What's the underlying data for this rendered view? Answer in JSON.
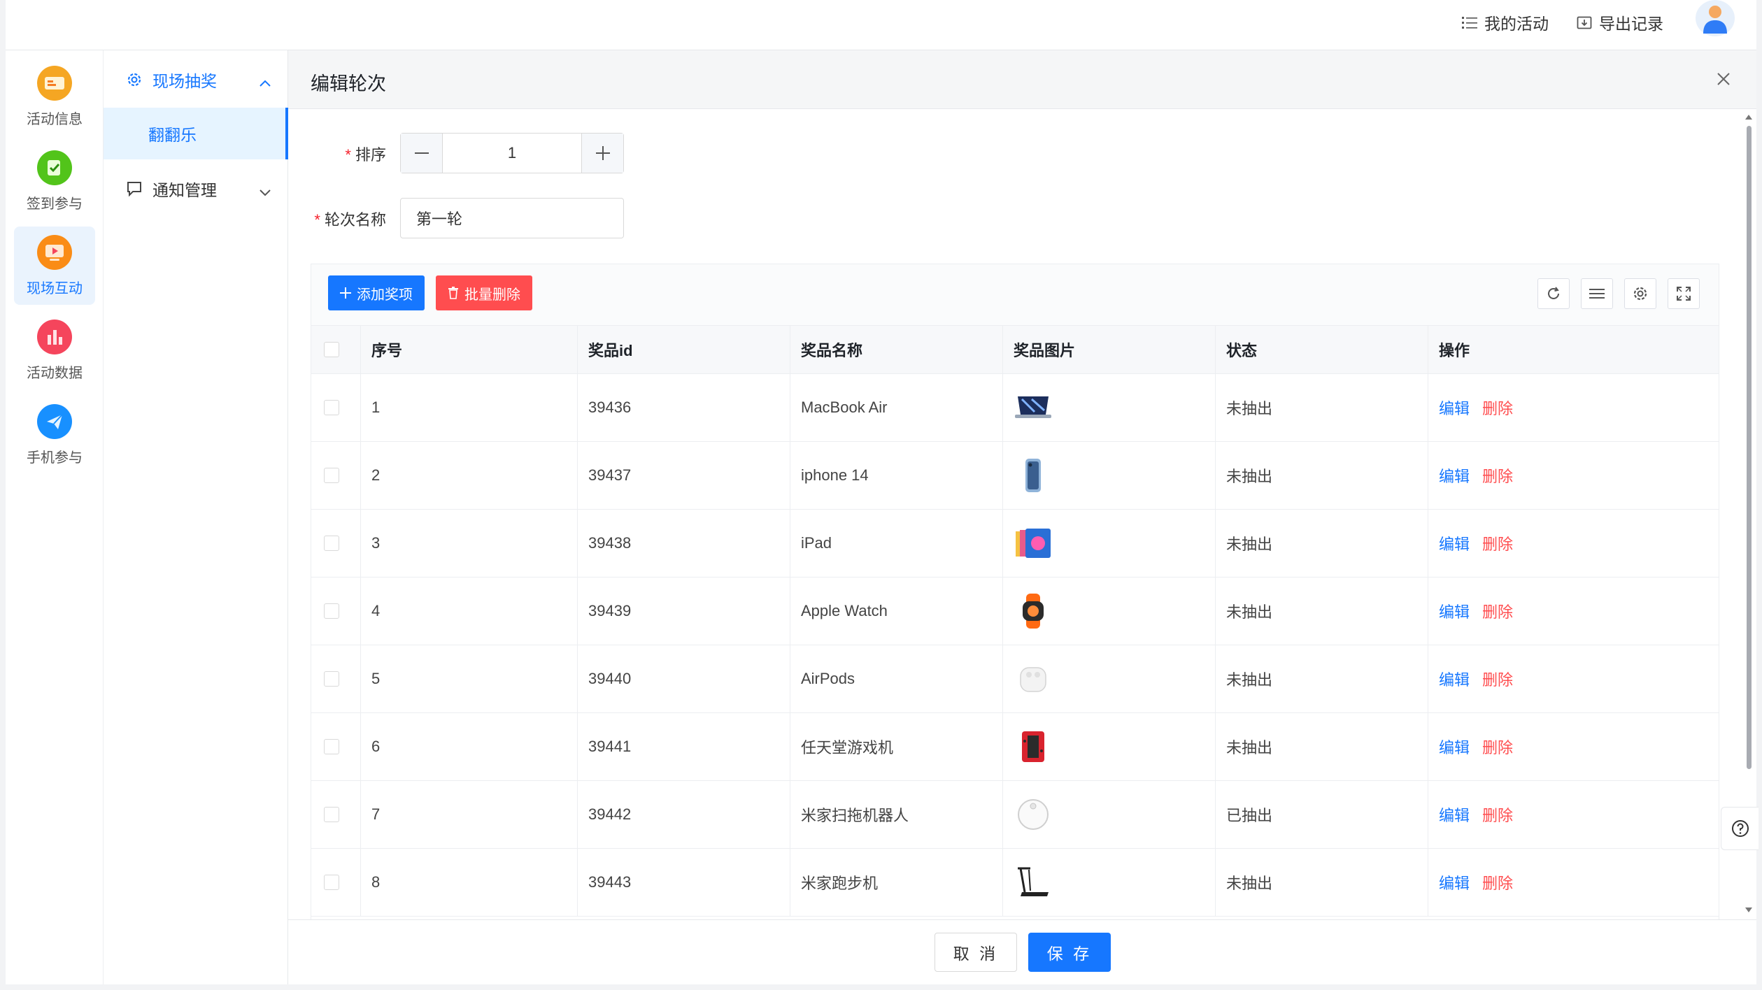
{
  "header": {
    "my_activities": "我的活动",
    "export_records": "导出记录"
  },
  "rail": {
    "items": [
      {
        "label": "活动信息",
        "icon": "ticket-icon",
        "color": "#f5a623"
      },
      {
        "label": "签到参与",
        "icon": "checkin-icon",
        "color": "#52c41a"
      },
      {
        "label": "现场互动",
        "icon": "live-play-icon",
        "color": "#fa8c16"
      },
      {
        "label": "活动数据",
        "icon": "bar-chart-icon",
        "color": "#f5455c"
      },
      {
        "label": "手机参与",
        "icon": "paper-plane-icon",
        "color": "#1890ff"
      }
    ],
    "active_index": 2
  },
  "submenu": {
    "group1": "现场抽奖",
    "group1_item": "翻翻乐",
    "group2": "通知管理"
  },
  "drawer": {
    "title": "编辑轮次",
    "sort_label": "排序",
    "sort_value": "1",
    "round_name_label": "轮次名称",
    "round_name_value": "第一轮",
    "add_prize": "添加奖项",
    "batch_delete": "批量删除",
    "cancel": "取 消",
    "save": "保 存"
  },
  "table": {
    "columns": [
      "序号",
      "奖品id",
      "奖品名称",
      "奖品图片",
      "状态",
      "操作"
    ],
    "edit_label": "编辑",
    "delete_label": "删除",
    "rows": [
      {
        "no": "1",
        "id": "39436",
        "name": "MacBook Air",
        "image": "laptop-icon",
        "status": "未抽出"
      },
      {
        "no": "2",
        "id": "39437",
        "name": "iphone 14",
        "image": "phone-icon",
        "status": "未抽出"
      },
      {
        "no": "3",
        "id": "39438",
        "name": "iPad",
        "image": "tablet-icon",
        "status": "未抽出"
      },
      {
        "no": "4",
        "id": "39439",
        "name": "Apple Watch",
        "image": "watch-icon",
        "status": "未抽出"
      },
      {
        "no": "5",
        "id": "39440",
        "name": "AirPods",
        "image": "earbuds-icon",
        "status": "未抽出"
      },
      {
        "no": "6",
        "id": "39441",
        "name": "任天堂游戏机",
        "image": "game-console-icon",
        "status": "未抽出"
      },
      {
        "no": "7",
        "id": "39442",
        "name": "米家扫拖机器人",
        "image": "robot-vacuum-icon",
        "status": "已抽出"
      },
      {
        "no": "8",
        "id": "39443",
        "name": "米家跑步机",
        "image": "treadmill-icon",
        "status": "未抽出"
      }
    ]
  },
  "colors": {
    "primary": "#1677ff",
    "danger": "#ff4d4f"
  }
}
